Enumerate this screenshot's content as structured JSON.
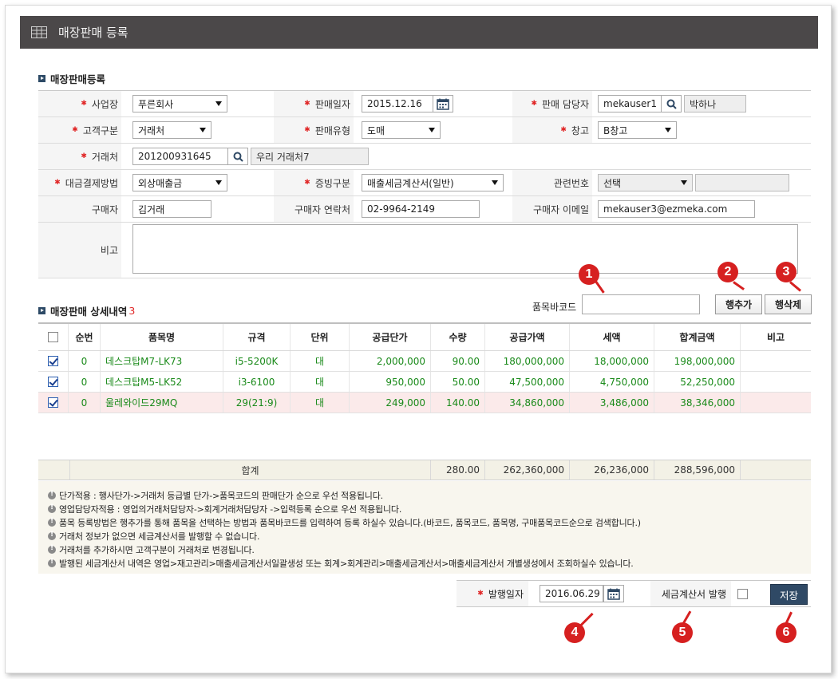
{
  "window": {
    "title": "매장판매 등록"
  },
  "section_form": {
    "title": "매장판매등록"
  },
  "form": {
    "business_label": "사업장",
    "business_value": "푸른회사",
    "sale_date_label": "판매일자",
    "sale_date_value": "2015.12.16",
    "manager_label": "판매 담당자",
    "manager_id": "mekauser1",
    "manager_name": "박하나",
    "customer_type_label": "고객구분",
    "customer_type_value": "거래처",
    "sale_type_label": "판매유형",
    "sale_type_value": "도매",
    "warehouse_label": "창고",
    "warehouse_value": "B창고",
    "client_label": "거래처",
    "client_code": "201200931645",
    "client_name": "우리 거래처7",
    "payment_label": "대금결제방법",
    "payment_value": "외상매출금",
    "proof_label": "증빙구분",
    "proof_value": "매출세금계산서(일반)",
    "related_label": "관련번호",
    "related_value": "선택",
    "buyer_label": "구매자",
    "buyer_value": "김거래",
    "buyer_phone_label": "구매자 연락처",
    "buyer_phone_value": "02-9964-2149",
    "buyer_email_label": "구매자 이메일",
    "buyer_email_value": "mekauser3@ezmeka.com",
    "memo_label": "비고"
  },
  "section_detail": {
    "title": "매장판매 상세내역",
    "count": "3"
  },
  "toolbar": {
    "barcode_label": "품목바코드",
    "add_row": "행추가",
    "del_row": "행삭제"
  },
  "grid": {
    "headers": [
      "순번",
      "품목명",
      "규격",
      "단위",
      "공급단가",
      "수량",
      "공급가액",
      "세액",
      "합계금액",
      "비고"
    ],
    "rows": [
      {
        "checked": true,
        "no": "0",
        "name": "데스크탑M7-LK73",
        "spec": "i5-5200K",
        "unit": "대",
        "price": "2,000,000",
        "qty": "90.00",
        "supply": "180,000,000",
        "tax": "18,000,000",
        "total": "198,000,000",
        "memo": ""
      },
      {
        "checked": true,
        "no": "0",
        "name": "데스크탑M5-LK52",
        "spec": "i3-6100",
        "unit": "대",
        "price": "950,000",
        "qty": "50.00",
        "supply": "47,500,000",
        "tax": "4,750,000",
        "total": "52,250,000",
        "memo": ""
      },
      {
        "checked": true,
        "no": "0",
        "name": "울레와이드29MQ",
        "spec": "29(21:9)",
        "unit": "대",
        "price": "249,000",
        "qty": "140.00",
        "supply": "34,860,000",
        "tax": "3,486,000",
        "total": "38,346,000",
        "memo": ""
      }
    ],
    "totals": {
      "label": "합계",
      "qty": "280.00",
      "supply": "262,360,000",
      "tax": "26,236,000",
      "total": "288,596,000"
    }
  },
  "notes": [
    "단가적용 : 행사단가->거래처 등급별 단가->품목코드의 판매단가 순으로 우선 적용됩니다.",
    "영업담당자적용 : 영업의거래처담당자->회계거래처담당자 ->입력등록 순으로 우선 적용됩니다.",
    "품목 등록방법은 행추가를 통해 품목을 선택하는 방법과 품목바코드를 입력하여 등록 하실수 있습니다.(바코드, 품목코드, 품목명, 구매품목코드순으로 검색합니다.)",
    "거래처 정보가 없으면 세금계산서를 발행할 수 없습니다.",
    "거래처를 추가하시면 고객구분이 거래처로 변경됩니다.",
    "발행된 세금계산서 내역은 영업>재고관리>매출세금계산서일괄생성 또는 회계>회계관리>매출세금계산서>매출세금계산서 개별생성에서 조회하실수 있습니다."
  ],
  "bottom": {
    "issue_date_label": "발행일자",
    "issue_date_value": "2016.06.29",
    "tax_invoice_label": "세금계산서 발행",
    "save": "저장"
  },
  "callouts": [
    "1",
    "2",
    "3",
    "4",
    "5",
    "6"
  ],
  "colors": {
    "title_bar": "#4b4849",
    "accent_red": "#d62020",
    "save_button": "#2f4965",
    "item_green": "#1a8a1a"
  }
}
